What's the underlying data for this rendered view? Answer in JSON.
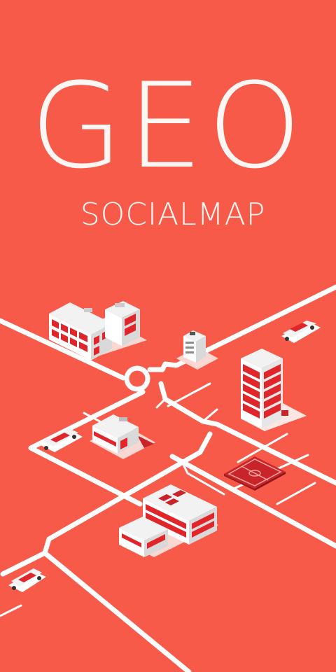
{
  "app": {
    "title": "GEO",
    "subtitle": "SOCIALMAP"
  },
  "colors": {
    "background": "#f75a48",
    "road": "#ffffff",
    "text": "#fdf6f3",
    "building_accent": "#e0262b",
    "building_wall": "#ffffff",
    "building_shade": "#d9d9d9"
  },
  "illustration": {
    "icons": [
      "city-map-illustration",
      "school-building-icon",
      "small-office-icon",
      "apartment-tower-icon",
      "house-icon",
      "hospital-building-icon",
      "football-field-icon",
      "car-icon"
    ]
  }
}
